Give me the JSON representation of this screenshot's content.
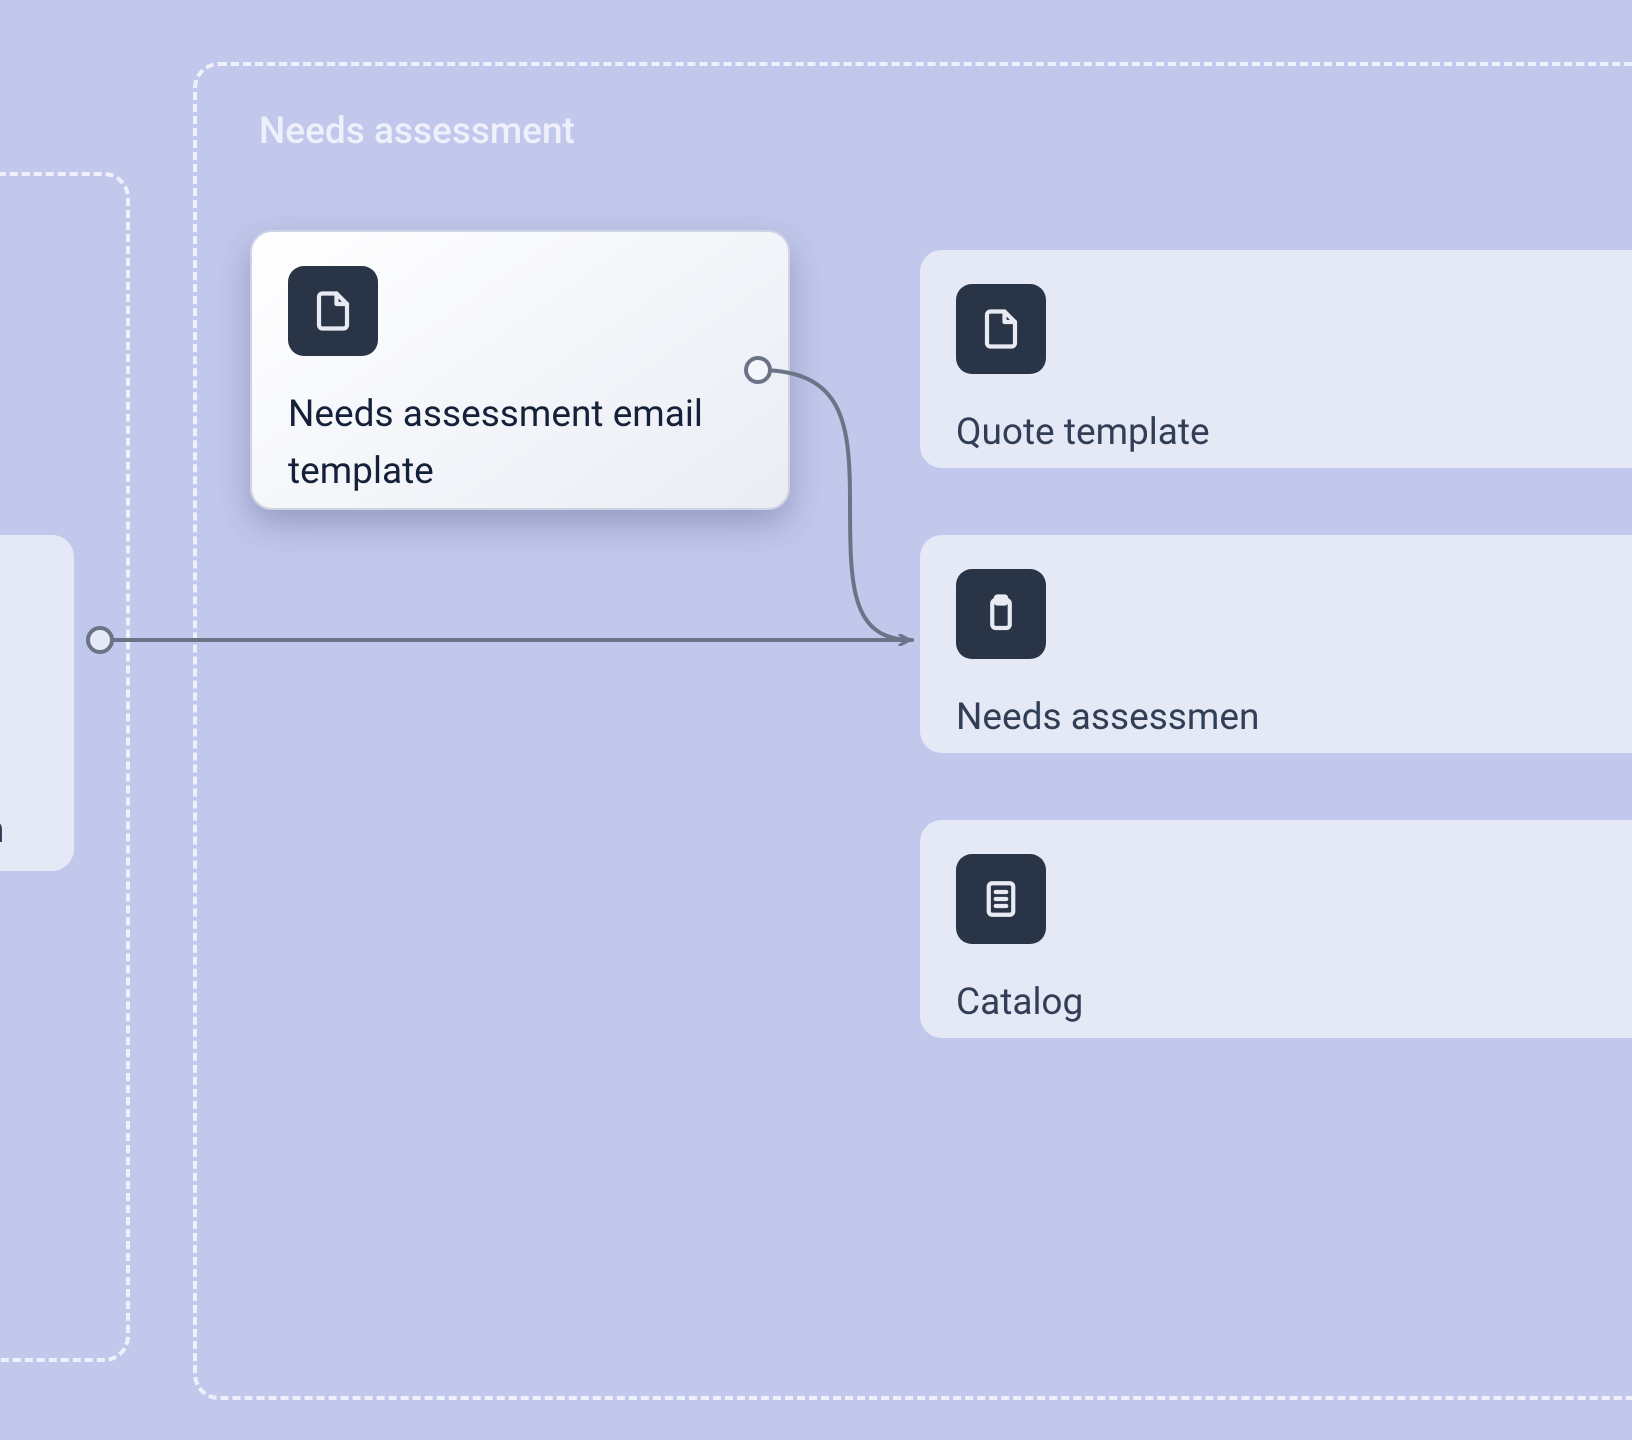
{
  "colors": {
    "background": "#c2c8ec",
    "group_border": "#eef0fb",
    "group_title": "#eef0fb",
    "node_bg_muted": "#e5e9f5",
    "node_icon_bg": "#2a3447",
    "node_text": "#152138",
    "connector": "#6b7387"
  },
  "groups": {
    "left": {
      "title_visible": false
    },
    "right": {
      "title": "Needs assessment"
    }
  },
  "nodes": {
    "partial_left": {
      "label_fragment": "m",
      "icon": "document-icon"
    },
    "highlight": {
      "label": "Needs assessment email template",
      "icon": "document-icon"
    },
    "quote": {
      "label": "Quote template",
      "icon": "document-icon"
    },
    "needs_form": {
      "label": "Needs assessmen",
      "icon": "clipboard-icon"
    },
    "catalog": {
      "label": "Catalog",
      "icon": "list-icon"
    }
  },
  "connections": [
    {
      "from": "partial_left",
      "to": "needs_form",
      "style": "straight-arrow"
    },
    {
      "from": "highlight",
      "to": "needs_form",
      "style": "curved-merge"
    }
  ]
}
